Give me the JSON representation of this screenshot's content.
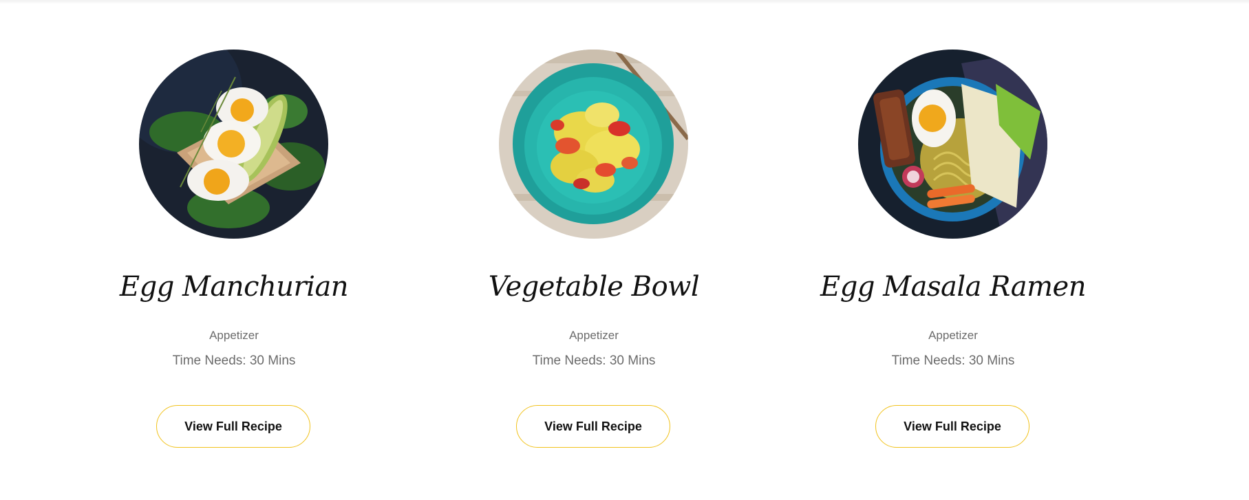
{
  "theme": {
    "accent": "#f1c21b",
    "title_color": "#111111",
    "muted_text": "#6b6b6b"
  },
  "recipes": [
    {
      "title": "Egg Manchurian",
      "category": "Appetizer",
      "time": "Time Needs: 30 Mins",
      "button_label": "View Full Recipe",
      "image": "egg-avocado-toast-photo"
    },
    {
      "title": "Vegetable Bowl",
      "category": "Appetizer",
      "time": "Time Needs: 30 Mins",
      "button_label": "View Full Recipe",
      "image": "vegetable-scramble-bowl-photo"
    },
    {
      "title": "Egg Masala Ramen",
      "category": "Appetizer",
      "time": "Time Needs: 30 Mins",
      "button_label": "View Full Recipe",
      "image": "ramen-bowl-photo"
    }
  ]
}
